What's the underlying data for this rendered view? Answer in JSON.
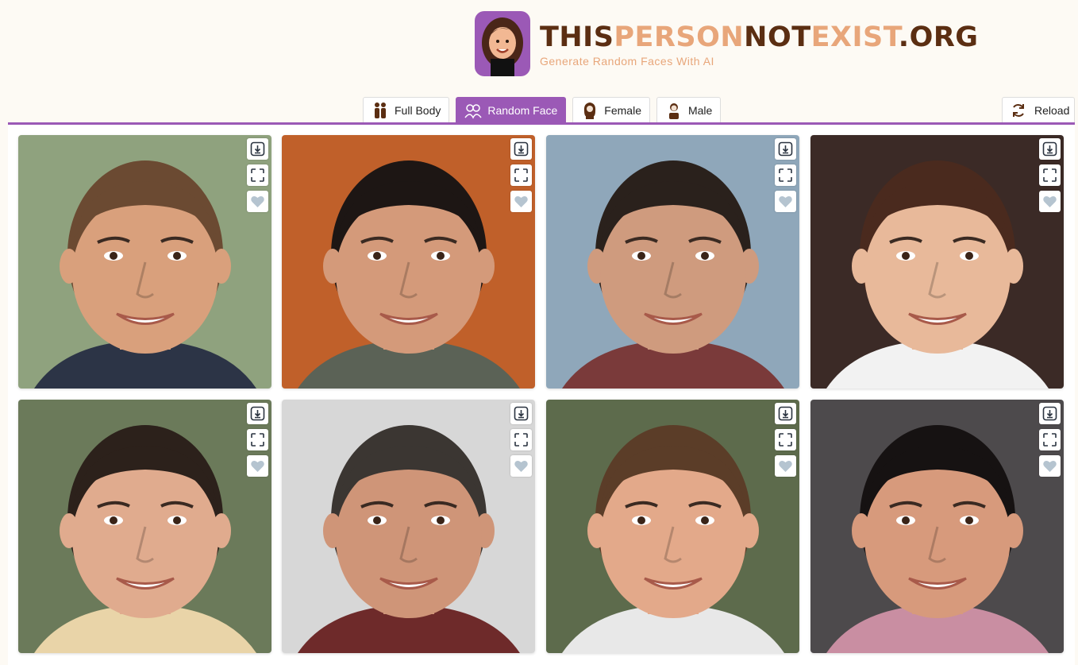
{
  "site": {
    "title_parts": [
      "THIS",
      "PERSON",
      "NOT",
      "EXIST",
      ".ORG"
    ],
    "tagline": "Generate Random Faces With AI"
  },
  "tabs": [
    {
      "label": "Full Body",
      "icon": "full-body-icon",
      "active": false
    },
    {
      "label": "Random Face",
      "icon": "random-face-icon",
      "active": true
    },
    {
      "label": "Female",
      "icon": "female-icon",
      "active": false
    },
    {
      "label": "Male",
      "icon": "male-icon",
      "active": false
    }
  ],
  "reload": {
    "label": "Reload",
    "icon": "reload-icon"
  },
  "colors": {
    "accent": "#9b59b6",
    "brand_dark": "#5b2e12",
    "brand_light": "#e8a67a"
  },
  "cards": [
    {
      "name": "face-card-1",
      "bg": "#8fa27e",
      "skin": "#d9a07c",
      "hair": "#6b4a32",
      "shirt": "#2c3446"
    },
    {
      "name": "face-card-2",
      "bg": "#c0602a",
      "skin": "#d49a7a",
      "hair": "#1d1614",
      "shirt": "#5b6256"
    },
    {
      "name": "face-card-3",
      "bg": "#8fa7ba",
      "skin": "#cf9b7e",
      "hair": "#2a211c",
      "shirt": "#7a3a3a"
    },
    {
      "name": "face-card-4",
      "bg": "#3b2a26",
      "skin": "#e8b99a",
      "hair": "#4a2a1e",
      "shirt": "#f2f2f2"
    },
    {
      "name": "face-card-5",
      "bg": "#6b7a5a",
      "skin": "#e0ab8e",
      "hair": "#2c211b",
      "shirt": "#e9d4a8"
    },
    {
      "name": "face-card-6",
      "bg": "#d7d7d7",
      "skin": "#cf9578",
      "hair": "#3b3632",
      "shirt": "#6e2a2a"
    },
    {
      "name": "face-card-7",
      "bg": "#5d6b4c",
      "skin": "#e3a98a",
      "hair": "#5b3d28",
      "shirt": "#e8e8e8"
    },
    {
      "name": "face-card-8",
      "bg": "#4d4a4c",
      "skin": "#d79a7c",
      "hair": "#161212",
      "shirt": "#c98ea2"
    }
  ],
  "card_buttons": [
    "download-icon",
    "fullscreen-icon",
    "heart-icon"
  ]
}
